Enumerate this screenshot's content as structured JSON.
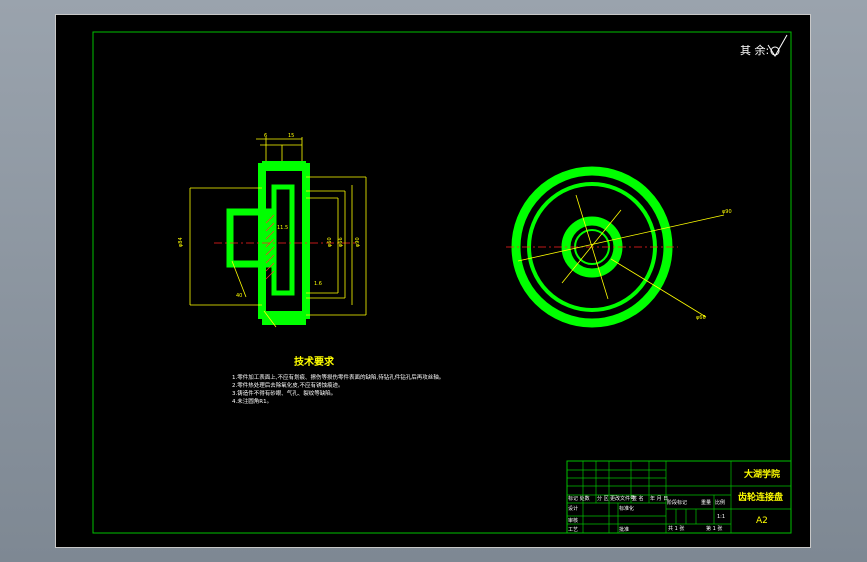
{
  "drawing": {
    "roughness_note": "其 余:",
    "tech_req_title": "技术要求",
    "tech_req_items": [
      "1.零件加工表面上,不应有划痕、擦伤等损伤零件表面的缺陷,待钻孔件钻孔后再攻丝轴。",
      "2.零件热处理后去除氧化皮,不应有锈蚀痕迹。",
      "3.铸造件不得有砂眼、气孔、裂纹等缺陷。",
      "4.未注圆角R1。"
    ]
  },
  "title_block": {
    "school": "大湖学院",
    "part_name": "齿轮连接盘",
    "sheet_size": "A2",
    "scale_label": "比例",
    "scale_value": "1:1",
    "row_labels": [
      "标记 处数",
      "分 区",
      "更改文件号",
      "签 名",
      "年 月 日"
    ],
    "design_label": "设计",
    "std_label": "标准化",
    "review_label": "审核",
    "process_label": "工艺",
    "approve_label": "批准",
    "stage_label": "阶段标记",
    "weight_label": "重量",
    "sheets_label": "共 1 张",
    "sheet_no_label": "第 1 张"
  },
  "colors": {
    "frame": "#00c000",
    "part": "#00ff00",
    "dim": "#ffff00",
    "center": "#ff0000",
    "text": "#ffffff"
  }
}
